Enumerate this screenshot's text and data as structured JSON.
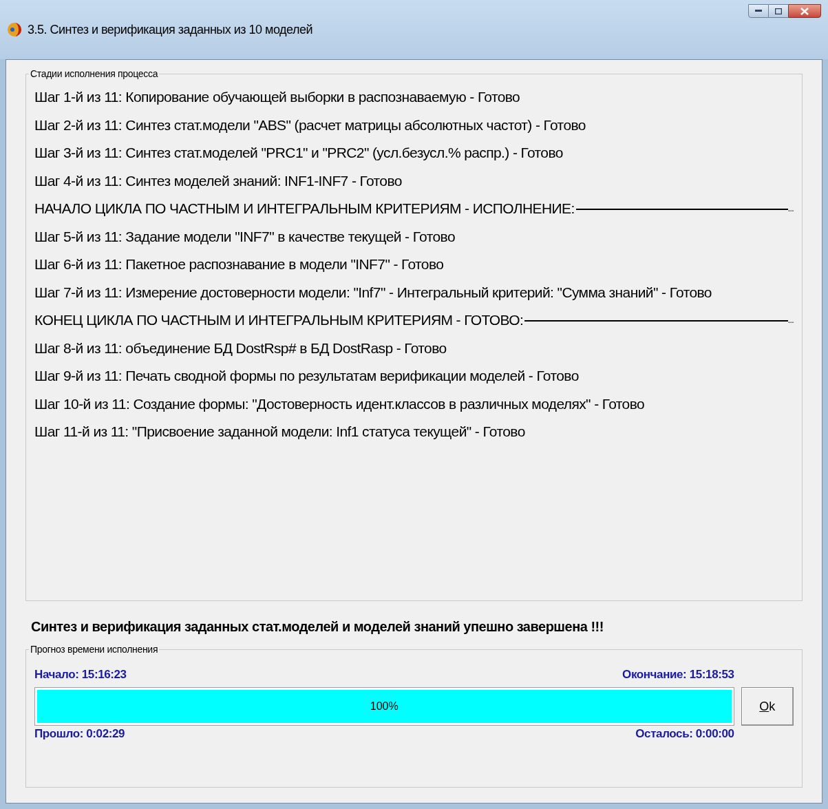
{
  "window": {
    "title": "3.5. Синтез и верификация заданных из 10 моделей"
  },
  "stages": {
    "legend": "Стадии исполнения процесса",
    "lines": [
      {
        "kind": "step",
        "text": "Шаг 1-й из 11: Копирование обучающей выборки в распознаваемую - Готово"
      },
      {
        "kind": "step",
        "text": "Шаг 2-й из 11: Синтез стат.модели \"ABS\" (расчет матрицы абсолютных частот) - Готово"
      },
      {
        "kind": "step",
        "text": "Шаг 3-й из 11: Синтез стат.моделей \"PRC1\" и \"PRC2\" (усл.безусл.% распр.) - Готово"
      },
      {
        "kind": "step",
        "text": "Шаг 4-й из 11: Синтез моделей знаний: INF1-INF7 - Готово"
      },
      {
        "kind": "separator",
        "text": "НАЧАЛО ЦИКЛА ПО ЧАСТНЫМ И ИНТЕГРАЛЬНЫМ КРИТЕРИЯМ - ИСПОЛНЕНИЕ:",
        "tail": "..."
      },
      {
        "kind": "step",
        "text": "Шаг 5-й из 11: Задание модели \"INF7\" в качестве текущей - Готово"
      },
      {
        "kind": "step",
        "text": "Шаг 6-й из 11: Пакетное распознавание в модели \"INF7\" - Готово"
      },
      {
        "kind": "step",
        "text": "Шаг 7-й из 11: Измерение достоверности модели: \"Inf7\" - Интегральный критерий: \"Сумма знаний\" - Готово"
      },
      {
        "kind": "separator",
        "text": "КОНЕЦ ЦИКЛА ПО ЧАСТНЫМ И ИНТЕГРАЛЬНЫМ КРИТЕРИЯМ - ГОТОВО:",
        "tail": "..."
      },
      {
        "kind": "step",
        "text": "Шаг 8-й из 11: объединение БД DostRsp# в БД DostRasp - Готово"
      },
      {
        "kind": "step",
        "text": "Шаг 9-й из 11: Печать сводной формы по результатам верификации моделей - Готово"
      },
      {
        "kind": "step",
        "text": "Шаг 10-й из 11: Создание формы: \"Достоверность идент.классов в различных моделях\" - Готово"
      },
      {
        "kind": "step",
        "text": "Шаг 11-й из 11: \"Присвоение заданной модели: Inf1 статуса текущей\" - Готово"
      }
    ]
  },
  "status_message": "Синтез и верификация заданных стат.моделей и моделей знаний упешно завершена !!!",
  "forecast": {
    "legend": "Прогноз времени исполнения",
    "start": "Начало: 15:16:23",
    "end": "Окончание: 15:18:53",
    "progress": {
      "level": 1.0,
      "reading": "100%"
    },
    "elapsed": "Прошло: 0:02:29",
    "remaining": "Осталось: 0:00:00"
  },
  "ok_button": {
    "label": "Ok"
  }
}
